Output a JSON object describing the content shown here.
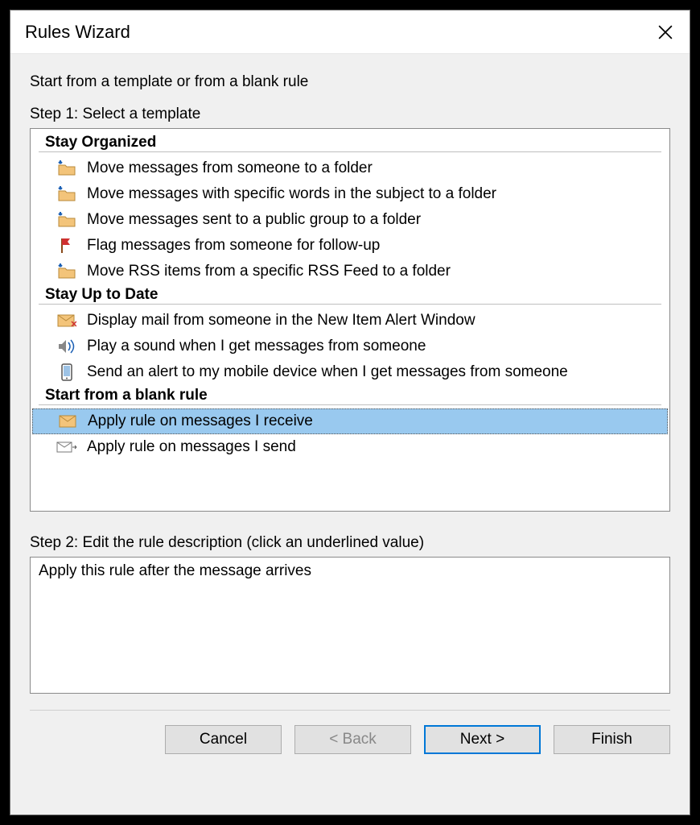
{
  "window": {
    "title": "Rules Wizard"
  },
  "instruction": "Start from a template or from a blank rule",
  "step1_label": "Step 1: Select a template",
  "groups": [
    {
      "header": "Stay Organized",
      "items": [
        {
          "icon": "folder-arrow",
          "label": "Move messages from someone to a folder"
        },
        {
          "icon": "folder-arrow",
          "label": "Move messages with specific words in the subject to a folder"
        },
        {
          "icon": "folder-arrow",
          "label": "Move messages sent to a public group to a folder"
        },
        {
          "icon": "flag",
          "label": "Flag messages from someone for follow-up"
        },
        {
          "icon": "folder-arrow",
          "label": "Move RSS items from a specific RSS Feed to a folder"
        }
      ]
    },
    {
      "header": "Stay Up to Date",
      "items": [
        {
          "icon": "mail-alert",
          "label": "Display mail from someone in the New Item Alert Window"
        },
        {
          "icon": "sound",
          "label": "Play a sound when I get messages from someone"
        },
        {
          "icon": "mobile",
          "label": "Send an alert to my mobile device when I get messages from someone"
        }
      ]
    },
    {
      "header": "Start from a blank rule",
      "items": [
        {
          "icon": "envelope-in",
          "label": "Apply rule on messages I receive",
          "selected": true
        },
        {
          "icon": "envelope-out",
          "label": "Apply rule on messages I send"
        }
      ]
    }
  ],
  "step2_label": "Step 2: Edit the rule description (click an underlined value)",
  "description": "Apply this rule after the message arrives",
  "buttons": {
    "cancel": "Cancel",
    "back": "< Back",
    "next": "Next >",
    "finish": "Finish"
  }
}
